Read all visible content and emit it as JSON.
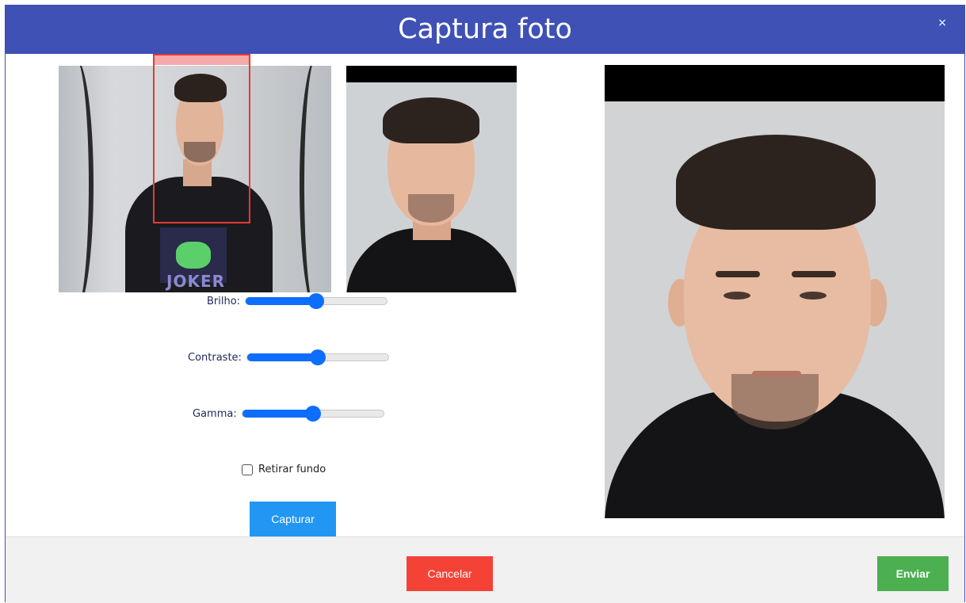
{
  "dialog": {
    "title": "Captura foto",
    "close_label": "×"
  },
  "camera": {
    "shirt_print_text": "JOKER"
  },
  "controls": {
    "brightness": {
      "label": "Brilho:",
      "value_pct": 50
    },
    "contrast": {
      "label": "Contraste:",
      "value_pct": 50
    },
    "gamma": {
      "label": "Gamma:",
      "value_pct": 50
    },
    "remove_background": {
      "label": "Retirar fundo",
      "checked": false
    },
    "capture_label": "Capturar"
  },
  "footer": {
    "cancel_label": "Cancelar",
    "send_label": "Enviar"
  },
  "colors": {
    "header": "#3f51b5",
    "capture_button": "#2196f3",
    "cancel_button": "#f44336",
    "send_button": "#4caf50",
    "slider_accent": "#0d6efd",
    "detection_box": "#e53935"
  }
}
